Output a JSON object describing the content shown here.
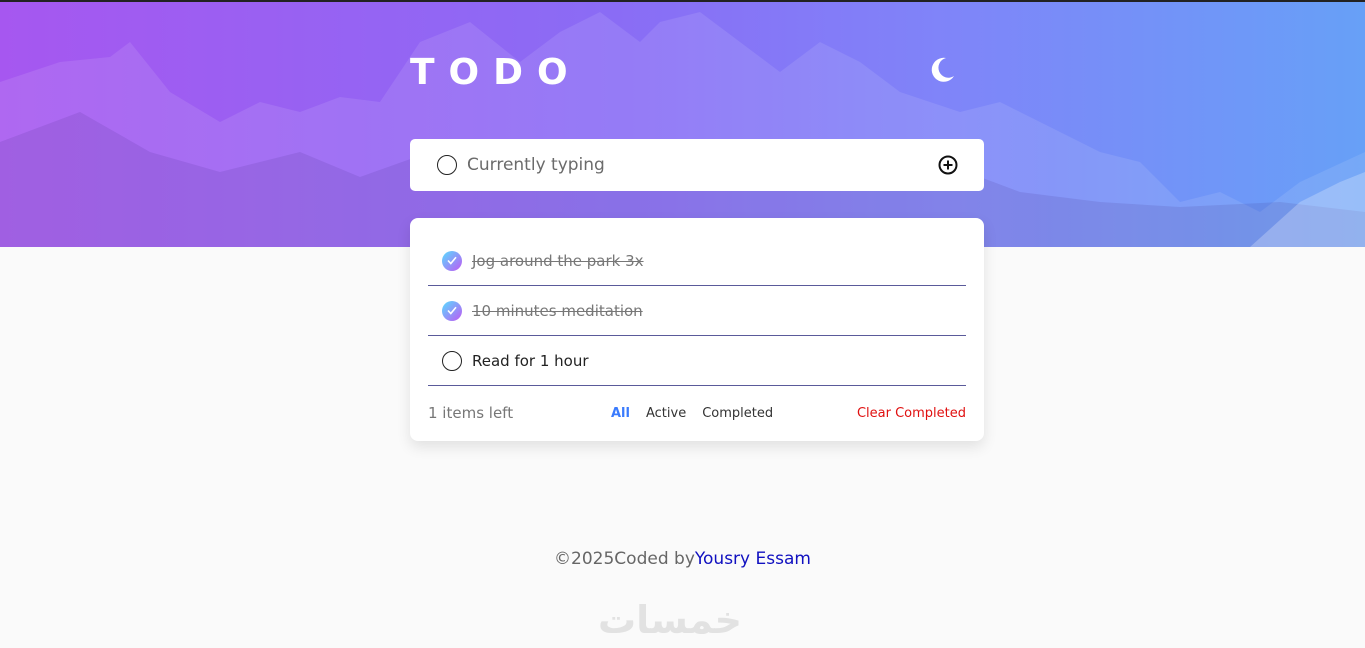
{
  "app": {
    "title": "TODO",
    "theme_icon": "moon-icon"
  },
  "new_todo": {
    "placeholder": "Currently typing",
    "add_icon": "plus-circle-icon"
  },
  "todos": [
    {
      "text": "Jog around the park 3x",
      "completed": true
    },
    {
      "text": "10 minutes meditation",
      "completed": true
    },
    {
      "text": "Read for 1 hour",
      "completed": false
    }
  ],
  "footer": {
    "items_left": "1 items left",
    "filters": [
      "All",
      "Active",
      "Completed"
    ],
    "active_filter": "All",
    "clear_label": "Clear Completed"
  },
  "credit": {
    "prefix": "©2025Coded by",
    "author": "Yousry Essam"
  },
  "watermark": "خمسات",
  "colors": {
    "accent": "#3a7bfd",
    "danger": "#e01010",
    "check_gradient_start": "#57ddff",
    "check_gradient_end": "#c058f3"
  }
}
